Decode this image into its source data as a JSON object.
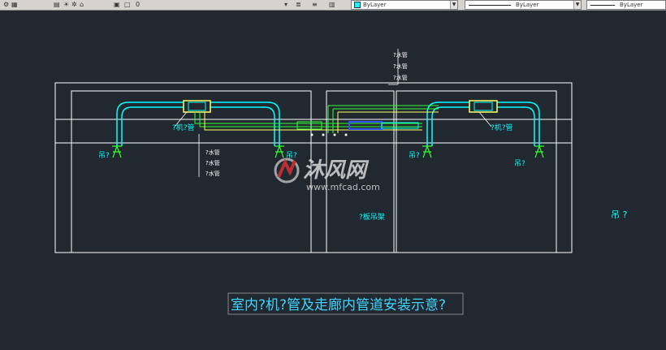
{
  "toolbar": {
    "layer_combo_value": "ByLayer",
    "linetype_combo_value": "ByLayer",
    "lineweight_combo_value": "ByLayer",
    "layer_state_value": "0",
    "color_accent": "#00ffff"
  },
  "drawing": {
    "main_title": "室内?机?管及走廊内管道安装示意?",
    "labels": {
      "left_top_a": "?机?管",
      "right_top_a": "?机?管",
      "left_floor": "吊?",
      "left_hanger": "吊?",
      "right_hanger": "吊?",
      "right_floor": "吊?",
      "corridor_support": "?板吊架",
      "far_right": "吊 ?",
      "pipe_group_top": [
        "?水管",
        "?水管",
        "?水管"
      ],
      "pipe_group_mid": [
        "?水管",
        "?水管",
        "?水管"
      ]
    },
    "colors": {
      "background": "#212830",
      "outline": "#ffffff",
      "duct": "#00ffff",
      "pipe_green": "#33ff33",
      "pipe_yellow": "#ffff66",
      "pipe_blue": "#3355ff"
    }
  },
  "watermark": {
    "brand": "沐风网",
    "url": "www.mfcad.com"
  }
}
